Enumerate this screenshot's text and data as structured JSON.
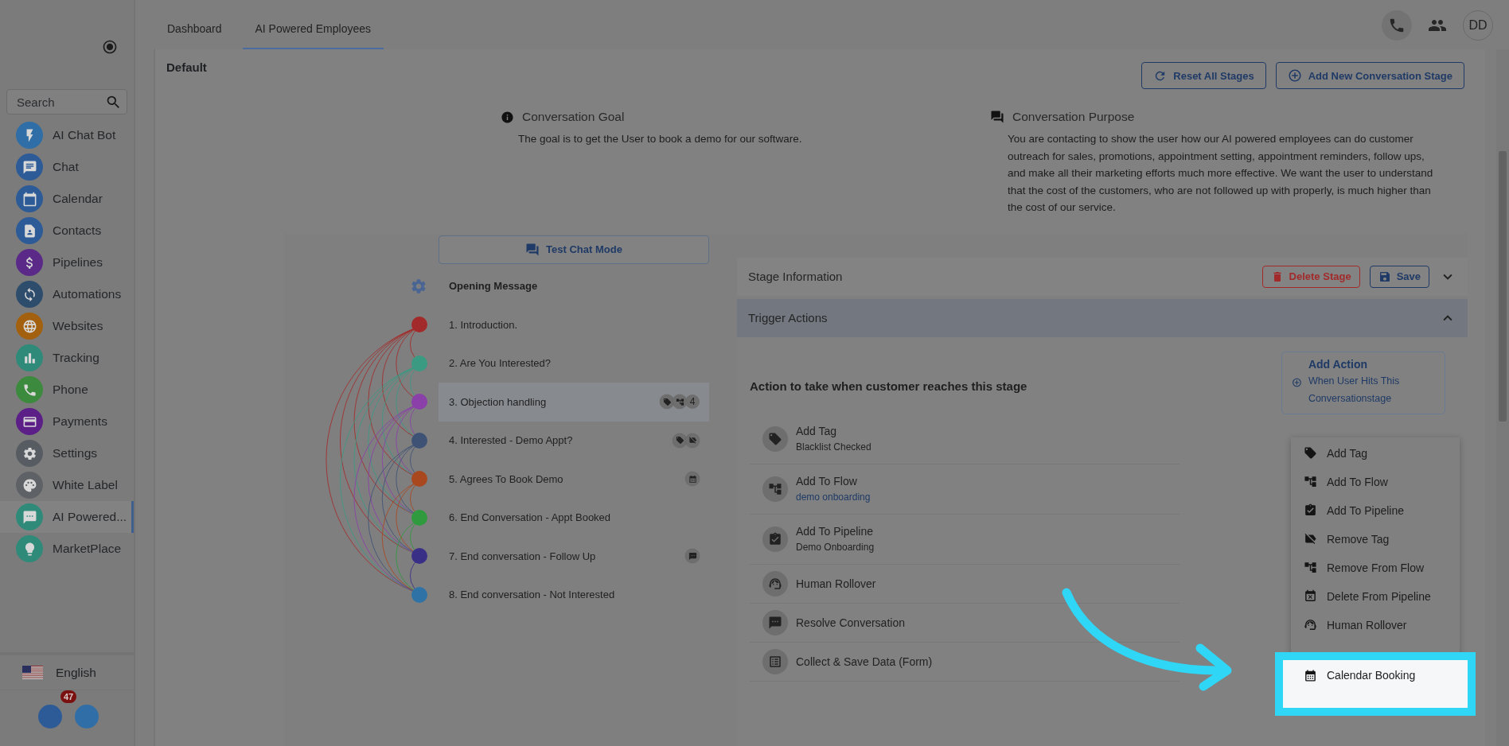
{
  "sidebar": {
    "search": {
      "placeholder": "Search"
    },
    "items": [
      {
        "kind": "bolt",
        "label": "AI Chat Bot",
        "color": "#2f6ea6",
        "selected": false
      },
      {
        "kind": "chat",
        "label": "Chat",
        "color": "#2c5b97",
        "selected": false
      },
      {
        "kind": "calendar",
        "label": "Calendar",
        "color": "#2c5b97",
        "selected": false
      },
      {
        "kind": "contacts",
        "label": "Contacts",
        "color": "#2c5b97",
        "selected": false
      },
      {
        "kind": "dollar",
        "label": "Pipelines",
        "color": "#5b2a88",
        "selected": false
      },
      {
        "kind": "sync",
        "label": "Automations",
        "color": "#2e4d6d",
        "selected": false
      },
      {
        "kind": "globe",
        "label": "Websites",
        "color": "#a3600e",
        "selected": false
      },
      {
        "kind": "chart",
        "label": "Tracking",
        "color": "#2f8a79",
        "selected": false
      },
      {
        "kind": "phone",
        "label": "Phone",
        "color": "#3b8a3d",
        "selected": false
      },
      {
        "kind": "card",
        "label": "Payments",
        "color": "#5c1f87",
        "selected": false
      },
      {
        "kind": "gear",
        "label": "Settings",
        "color": "#575c63",
        "selected": false
      },
      {
        "kind": "palette",
        "label": "White Label",
        "color": "#5e6267",
        "selected": false
      },
      {
        "kind": "sms",
        "label": "AI Powered...",
        "color": "#2f8a79",
        "selected": true
      },
      {
        "kind": "bulb",
        "label": "MarketPlace",
        "color": "#2f8a79",
        "selected": false
      }
    ],
    "language": "English",
    "badge": "47"
  },
  "tabs": [
    {
      "label": "Dashboard",
      "selected": false
    },
    {
      "label": "AI Powered Employees",
      "selected": true
    }
  ],
  "avatar": "DD",
  "title": "Default",
  "toolbar": [
    {
      "kind": "reset",
      "label": "Reset All Stages"
    },
    {
      "kind": "add",
      "label": "Add New Conversation Stage"
    }
  ],
  "goal": {
    "heading": "Conversation Goal",
    "text": "The goal is to get the User to book a demo for our software."
  },
  "purpose": {
    "heading": "Conversation Purpose",
    "text": "You are contacting to show the user how our AI powered employees can do customer outreach for sales, promotions, appointment setting, appointment reminders, follow ups, and make all their marketing efforts much more effective. We want the user to understand that the cost of the customers, who are not followed up with properly, is much higher than the cost of our service."
  },
  "test_chat_button": "Test Chat Mode",
  "opening_message": "Opening Message",
  "stages": [
    {
      "label": "1. Introduction.",
      "color": "#a32a2a",
      "selected": false
    },
    {
      "label": "2. Are You Interested?",
      "color": "#3a9a82",
      "selected": false
    },
    {
      "label": "3. Objection handling",
      "color": "#8a40a8",
      "selected": true,
      "badges": [
        {
          "kind": "tag"
        },
        {
          "kind": "flow"
        }
      ],
      "count": "4"
    },
    {
      "label": "4. Interested - Demo Appt?",
      "color": "#3e5275",
      "selected": false,
      "badges": [
        {
          "kind": "tag"
        },
        {
          "kind": "remove_tag"
        }
      ]
    },
    {
      "label": "5. Agrees To Book Demo",
      "color": "#a9481e",
      "selected": false,
      "badges": [
        {
          "kind": "calendar"
        }
      ]
    },
    {
      "label": "6. End Conversation - Appt Booked",
      "color": "#2f9a3e",
      "selected": false
    },
    {
      "label": "7. End conversation - Follow Up",
      "color": "#3a2f86",
      "selected": false,
      "badges": [
        {
          "kind": "chat"
        }
      ]
    },
    {
      "label": "8. End conversation - Not Interested",
      "color": "#2f73a6",
      "selected": false
    }
  ],
  "stage_info": {
    "title": "Stage Information",
    "expanded": false,
    "delete": "Delete Stage",
    "save": "Save"
  },
  "trigger": {
    "title": "Trigger Actions",
    "expanded": true
  },
  "actions_heading": "Action to take when customer reaches this stage",
  "add_action": {
    "title": "Add Action",
    "subtitle": "When User Hits This Conversationstage"
  },
  "actions": [
    {
      "kind": "tag",
      "title": "Add Tag",
      "detail": "Blacklist Checked",
      "link": false
    },
    {
      "kind": "flow",
      "title": "Add To Flow",
      "detail": "demo onboarding",
      "link": true
    },
    {
      "kind": "pipeline",
      "title": "Add To Pipeline",
      "detail": "Demo Onboarding",
      "link": false
    },
    {
      "kind": "human",
      "title": "Human Rollover"
    },
    {
      "kind": "chat",
      "title": "Resolve Conversation"
    },
    {
      "kind": "form",
      "title": "Collect & Save Data (Form)"
    }
  ],
  "menu": [
    {
      "kind": "tag",
      "label": "Add Tag",
      "highlighted": false
    },
    {
      "kind": "flow",
      "label": "Add To Flow",
      "highlighted": false
    },
    {
      "kind": "pipeline",
      "label": "Add To Pipeline",
      "highlighted": false
    },
    {
      "kind": "remove_tag",
      "label": "Remove Tag",
      "highlighted": false
    },
    {
      "kind": "remove_flow",
      "label": "Remove From Flow",
      "highlighted": false
    },
    {
      "kind": "delete_pipeline",
      "label": "Delete From Pipeline",
      "highlighted": false
    },
    {
      "kind": "human",
      "label": "Human Rollover",
      "highlighted": false
    },
    {
      "kind": "calendar",
      "label": "Calendar Booking",
      "highlighted": true
    }
  ]
}
